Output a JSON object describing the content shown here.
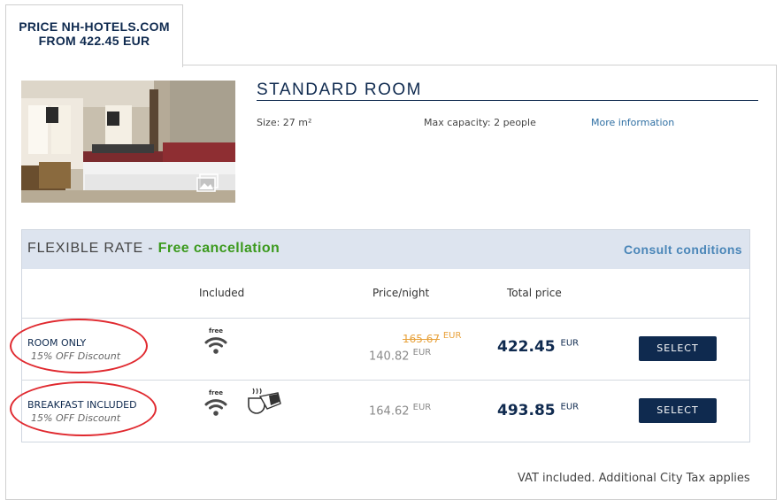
{
  "tab": {
    "line1": "PRICE NH-HOTELS.COM",
    "line2": "FROM 422.45 EUR"
  },
  "room": {
    "title": "STANDARD ROOM",
    "size": "Size: 27 m²",
    "capacity": "Max capacity: 2 people",
    "more_info": "More information"
  },
  "rate": {
    "name": "FLEXIBLE RATE",
    "separator": " - ",
    "free_cancel": "Free cancellation",
    "consult": "Consult conditions",
    "headers": {
      "included": "Included",
      "price_night": "Price/night",
      "total": "Total price"
    },
    "options": [
      {
        "name": "ROOM ONLY",
        "discount": "15% OFF Discount",
        "wifi_label": "free",
        "old_price": "165.67",
        "old_currency": "EUR",
        "price_night": "140.82",
        "night_currency": "EUR",
        "total": "422.45",
        "total_currency": "EUR",
        "button": "SELECT"
      },
      {
        "name": "BREAKFAST INCLUDED",
        "discount": "15% OFF Discount",
        "wifi_label": "free",
        "price_night": "164.62",
        "night_currency": "EUR",
        "total": "493.85",
        "total_currency": "EUR",
        "button": "SELECT"
      }
    ]
  },
  "footer": {
    "vat": "VAT included. Additional City Tax applies"
  },
  "colors": {
    "navy": "#0f2a4f",
    "green": "#3c9a1e",
    "link": "#4a86b8",
    "strike": "#e8a23c",
    "circle": "#e0292f"
  },
  "icons": [
    "wifi-icon",
    "breakfast-icon",
    "gallery-icon"
  ]
}
